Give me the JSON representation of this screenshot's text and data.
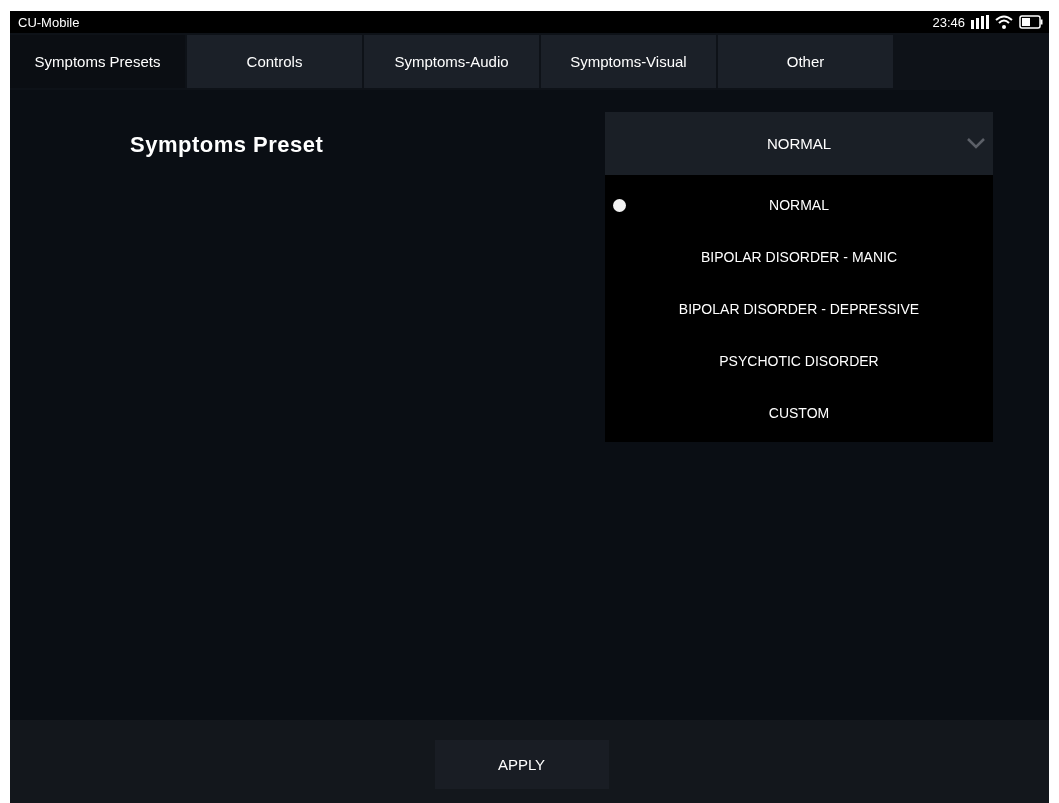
{
  "status_bar": {
    "app_name": "CU-Mobile",
    "time": "23:46"
  },
  "tabs": [
    {
      "label": "Symptoms Presets",
      "selected": true
    },
    {
      "label": "Controls",
      "selected": false
    },
    {
      "label": "Symptoms-Audio",
      "selected": false
    },
    {
      "label": "Symptoms-Visual",
      "selected": false
    },
    {
      "label": "Other",
      "selected": false
    }
  ],
  "heading": "Symptoms Preset",
  "dropdown": {
    "value": "NORMAL",
    "expanded": true,
    "options": [
      {
        "label": "NORMAL",
        "selected": true
      },
      {
        "label": "BIPOLAR DISORDER - MANIC",
        "selected": false
      },
      {
        "label": "BIPOLAR DISORDER - DEPRESSIVE",
        "selected": false
      },
      {
        "label": "PSYCHOTIC DISORDER",
        "selected": false
      },
      {
        "label": "CUSTOM",
        "selected": false
      }
    ]
  },
  "apply_button": "APPLY"
}
